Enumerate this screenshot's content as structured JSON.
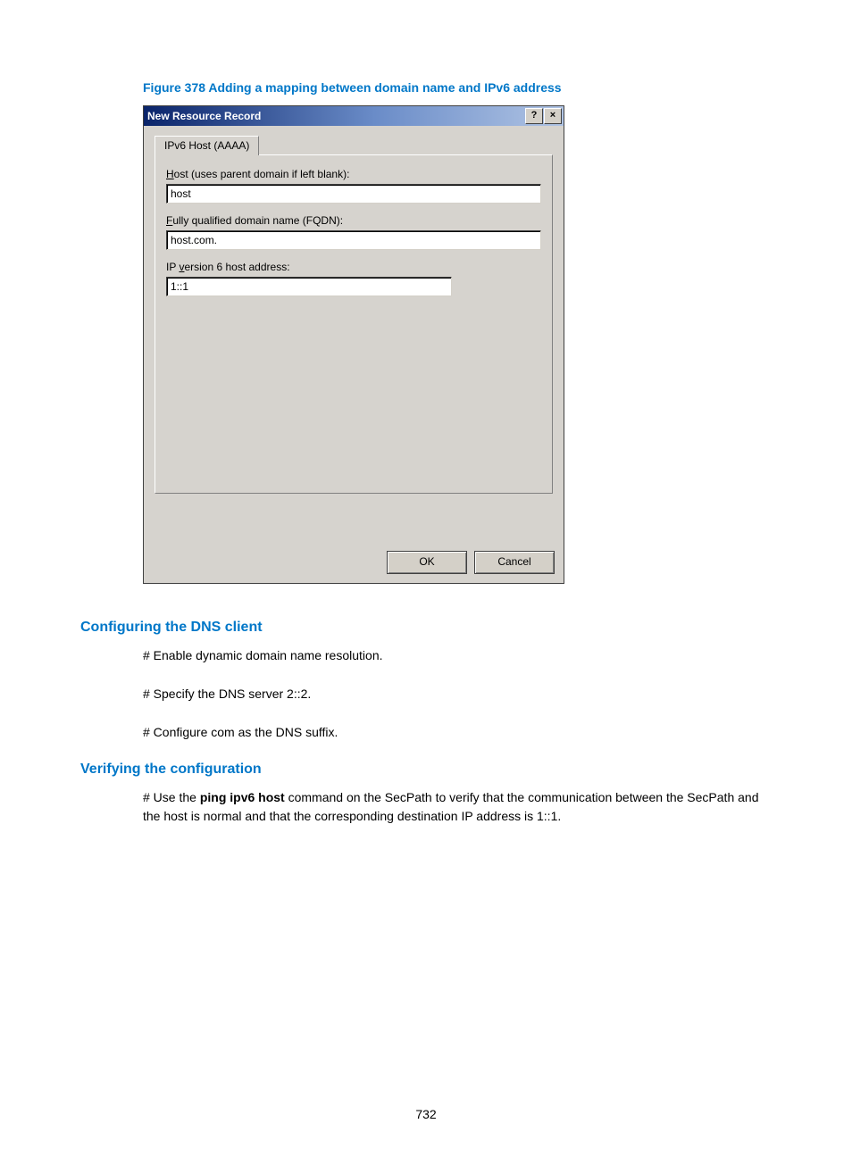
{
  "figure_caption": "Figure 378 Adding a mapping between domain name and IPv6 address",
  "dialog": {
    "title": "New Resource Record",
    "help_btn": "?",
    "close_btn": "×",
    "tab_label": "IPv6 Host (AAAA)",
    "host_label_pre": "H",
    "host_label_post": "ost (uses parent domain if left blank):",
    "host_value": "host",
    "fqdn_label_pre": "F",
    "fqdn_label_post": "ully qualified domain name (FQDN):",
    "fqdn_value": "host.com.",
    "ipv6_label_pre": "IP ",
    "ipv6_label_u": "v",
    "ipv6_label_post": "ersion 6 host address:",
    "ipv6_value": "1::1",
    "ok_label": "OK",
    "cancel_label": "Cancel"
  },
  "section1": {
    "heading": "Configuring the DNS client",
    "line1": "# Enable dynamic domain name resolution.",
    "line2": "# Specify the DNS server 2::2.",
    "line3": "# Configure com as the DNS suffix."
  },
  "section2": {
    "heading": "Verifying the configuration",
    "line1a": "# Use the ",
    "line1b": "ping ipv6 host",
    "line1c": " command on the SecPath to verify that the communication between the SecPath and the host is normal and that the corresponding destination IP address is 1::1."
  },
  "page_number": "732"
}
